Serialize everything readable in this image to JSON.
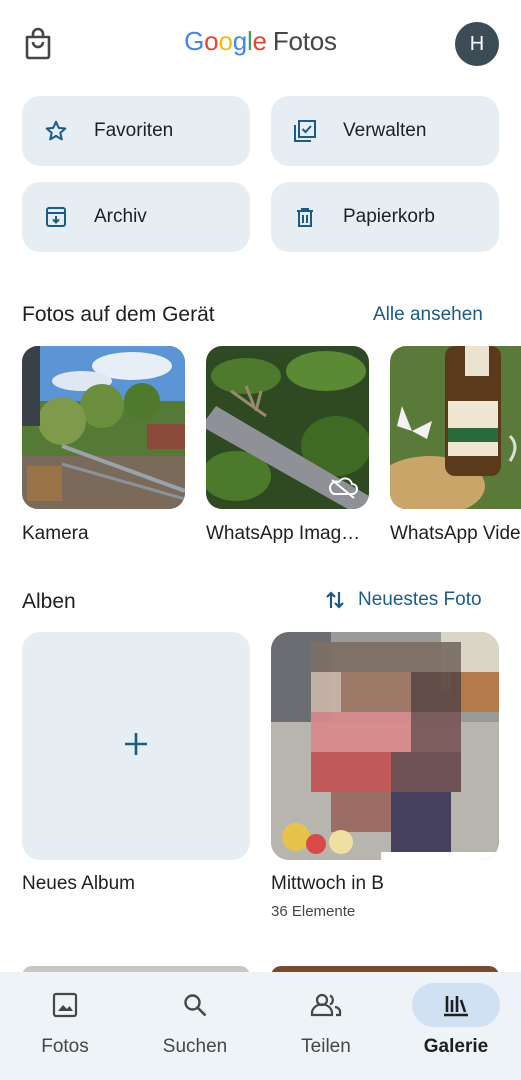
{
  "header": {
    "logo_google": [
      "G",
      "o",
      "o",
      "g",
      "l",
      "e"
    ],
    "logo_fotos": "Fotos",
    "avatar_initial": "H"
  },
  "quick_actions": [
    {
      "label": "Favoriten",
      "icon": "star-icon"
    },
    {
      "label": "Verwalten",
      "icon": "checklist-icon"
    },
    {
      "label": "Archiv",
      "icon": "archive-icon"
    },
    {
      "label": "Papierkorb",
      "icon": "trash-icon"
    }
  ],
  "device_photos": {
    "title": "Fotos auf dem Gerät",
    "link": "Alle ansehen",
    "folders": [
      {
        "label": "Kamera"
      },
      {
        "label": "WhatsApp Imag…"
      },
      {
        "label": "WhatsApp Vide"
      }
    ]
  },
  "albums": {
    "title": "Alben",
    "sort_label": "Neuestes Foto",
    "new_album_label": "Neues Album",
    "items": [
      {
        "label": "Mittwoch in B",
        "count": "36 Elemente"
      }
    ]
  },
  "bottom_nav": [
    {
      "label": "Fotos",
      "icon": "photo-icon",
      "active": false
    },
    {
      "label": "Suchen",
      "icon": "search-icon",
      "active": false
    },
    {
      "label": "Teilen",
      "icon": "people-icon",
      "active": false
    },
    {
      "label": "Galerie",
      "icon": "library-icon",
      "active": true
    }
  ],
  "colors": {
    "accent": "#1a5b8a",
    "tile_bg": "#e6eef4",
    "nav_bg": "#eef3f7",
    "nav_active_pill": "#cfe1f2",
    "avatar_bg": "#3c4c57"
  }
}
